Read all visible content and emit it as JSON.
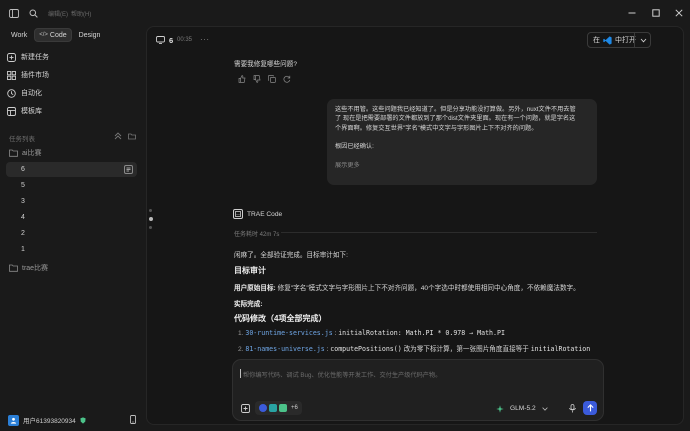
{
  "titlebar": {
    "menu_edit": "编辑(E)",
    "menu_help": "帮助(H)"
  },
  "sidebar": {
    "tabs": [
      {
        "label": "Work"
      },
      {
        "label": "Code",
        "prefix": "</>"
      },
      {
        "label": "Design"
      }
    ],
    "nav": [
      {
        "label": "新建任务",
        "icon": "new-task-icon"
      },
      {
        "label": "插件市场",
        "icon": "plugin-market-icon"
      },
      {
        "label": "自动化",
        "icon": "automation-icon"
      },
      {
        "label": "模板库",
        "icon": "template-icon"
      }
    ],
    "task_list_label": "任务列表",
    "group1": "ai比赛",
    "tasks": [
      "6",
      "5",
      "3",
      "4",
      "2",
      "1"
    ],
    "group2": "trae比赛",
    "user": "用户61393820934"
  },
  "header": {
    "task_num": "6",
    "time": "00:35",
    "open_in_prefix": "在",
    "open_in": "中打开"
  },
  "chat": {
    "q": "需要我修复哪些问题?",
    "bubble_lines": [
      "这些不用管。这些问题我已经知道了。但是分享功能没打算做。另外，nuxt文件不用去管",
      "了 现在是把需要部署的文件都放到了那个dist文件夹里面。现在有一个问题，就是字名这",
      "个界面啊。修复交互世界\"字名\"模式中文字与字形图片上下不对齐的问题。"
    ],
    "bubble_followup": "根因已经确认:",
    "bubble_more": "展示更多",
    "agent": "TRAE Code",
    "elapsed": "任务耗时 42m 7s",
    "done": "闲麻了。全部验证完成。目标审计如下:",
    "h_goal": "目标审计",
    "goal_label": "用户原始目标:",
    "goal_text": "修复\"字名\"模式文字与字形图片上下不对齐问题，40个字选中时都使用相同中心角度，不依赖魔法数字。",
    "achieve": "实际完成:",
    "h_changes": "代码修改（4项全部完成）",
    "change1_file": "30-runtime-services.js",
    "change1_code": "initialRotation: Math.PI * 0.978 → Math.PI",
    "change2_file": "81-names-universe.js",
    "change2_pre": "computePositions()",
    "change2_mid": " 改为零下标计算，第一张图片角度直接等于 ",
    "change2_post": "initialRotation"
  },
  "input": {
    "placeholder": "帮你编写代码、调试 Bug、优化性能等开发工作、交付生产级代码产物。",
    "plus_count": "+6",
    "model": "GLM-5.2"
  },
  "colors": {
    "accent": "#3b5bdb",
    "vscode_blue": "#1e88e5",
    "link": "#6fa6e6",
    "model_icon": "#4cc38a"
  }
}
